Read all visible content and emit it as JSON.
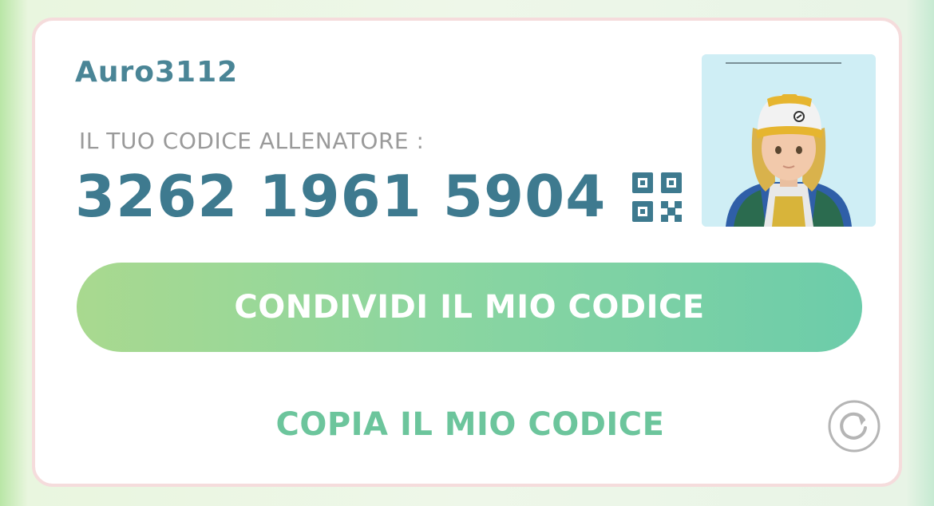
{
  "trainer": {
    "username": "Auro3112",
    "code_label": "IL TUO CODICE ALLENATORE :",
    "code_value": "3262 1961 5904"
  },
  "actions": {
    "share_label": "CONDIVIDI IL MIO CODICE",
    "copy_label": "COPIA IL MIO CODICE"
  },
  "icons": {
    "qr": "qr-code-icon",
    "refresh": "refresh-icon",
    "avatar": "trainer-avatar"
  },
  "colors": {
    "username": "#4a8596",
    "code": "#3e7a8f",
    "share_gradient_start": "#a9d98f",
    "share_gradient_end": "#6cccaa",
    "copy_text": "#6cc59c"
  }
}
